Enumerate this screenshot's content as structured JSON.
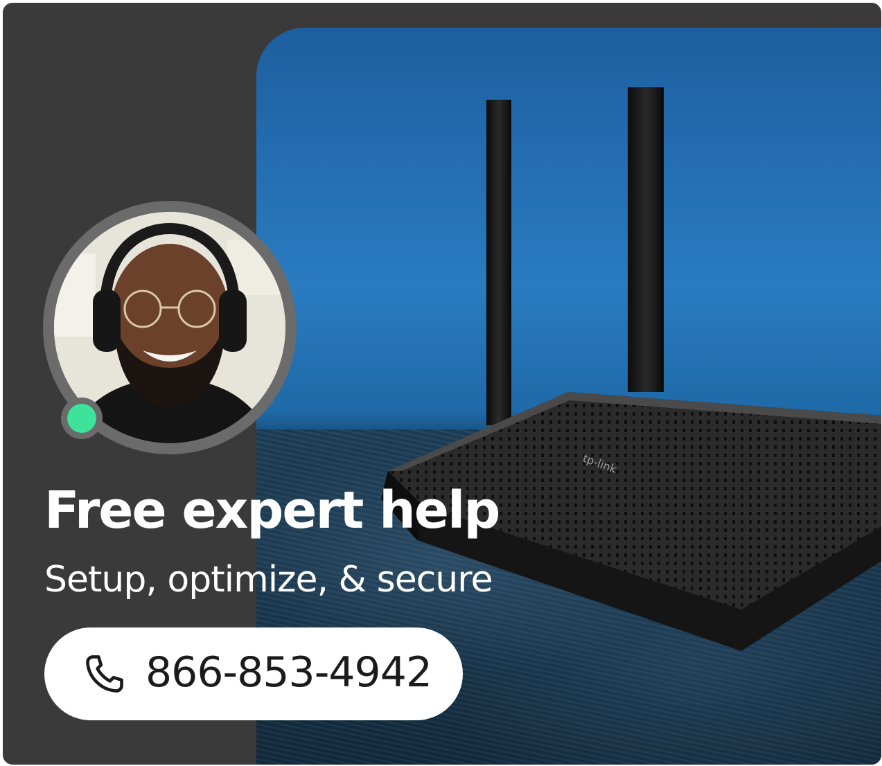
{
  "promo": {
    "headline": "Free expert help",
    "subhead": "Setup, optimize, & secure",
    "phone_number": "866-853-4942",
    "icons": {
      "phone": "phone-icon",
      "status": "online-status-icon"
    },
    "colors": {
      "card_background": "#3a3a3a",
      "status_online": "#3de39b",
      "button_background": "#ffffff",
      "text_primary": "#ffffff",
      "button_text": "#1b1b1b"
    },
    "images": {
      "hero": "wifi-router-photo",
      "agent": "support-agent-photo"
    }
  }
}
